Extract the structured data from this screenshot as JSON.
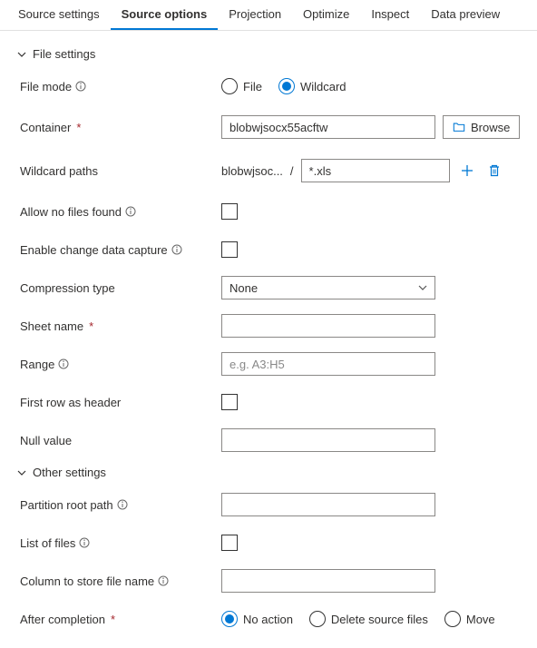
{
  "tabs": {
    "source_settings": "Source settings",
    "source_options": "Source options",
    "projection": "Projection",
    "optimize": "Optimize",
    "inspect": "Inspect",
    "data_preview": "Data preview"
  },
  "sections": {
    "file_settings": "File settings",
    "other_settings": "Other settings"
  },
  "labels": {
    "file_mode": "File mode",
    "container": "Container",
    "wildcard_paths": "Wildcard paths",
    "allow_no_files": "Allow no files found",
    "enable_cdc": "Enable change data capture",
    "compression_type": "Compression type",
    "sheet_name": "Sheet name",
    "range": "Range",
    "first_row_header": "First row as header",
    "null_value": "Null value",
    "partition_root": "Partition root path",
    "list_of_files": "List of files",
    "column_store_filename": "Column to store file name",
    "after_completion": "After completion",
    "required_marker": "*"
  },
  "values": {
    "container": "blobwjsocx55acftw",
    "wildcard_prefix": "blobwjsoc...",
    "wildcard_value": "*.xls",
    "compression_selected": "None",
    "range_placeholder": "e.g. A3:H5",
    "path_sep": "/"
  },
  "file_mode_options": {
    "file": "File",
    "wildcard": "Wildcard"
  },
  "after_completion_options": {
    "no_action": "No action",
    "delete": "Delete source files",
    "move": "Move"
  },
  "buttons": {
    "browse": "Browse"
  }
}
